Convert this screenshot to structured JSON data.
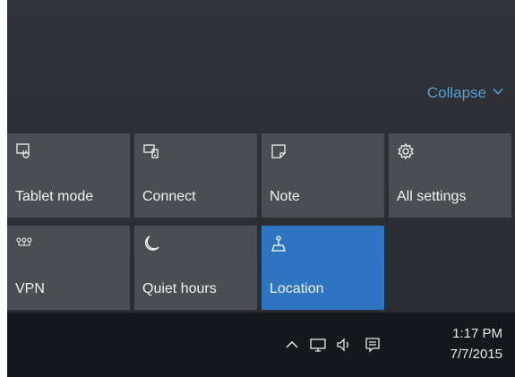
{
  "action_center": {
    "collapse_label": "Collapse",
    "tiles": [
      {
        "label": "Tablet mode",
        "icon": "tablet-mode-icon",
        "active": false
      },
      {
        "label": "Connect",
        "icon": "connect-icon",
        "active": false
      },
      {
        "label": "Note",
        "icon": "note-icon",
        "active": false
      },
      {
        "label": "All settings",
        "icon": "gear-icon",
        "active": false
      },
      {
        "label": "VPN",
        "icon": "vpn-icon",
        "active": false
      },
      {
        "label": "Quiet hours",
        "icon": "moon-icon",
        "active": false
      },
      {
        "label": "Location",
        "icon": "location-icon",
        "active": true
      }
    ]
  },
  "taskbar": {
    "tray_icons": [
      "chevron-up-icon",
      "network-icon",
      "volume-icon",
      "action-center-icon"
    ],
    "time": "1:17 PM",
    "date": "7/7/2015"
  },
  "colors": {
    "panel_bg": "#2c3035",
    "tile_bg": "#4a4d52",
    "active_tile_bg": "#2f74c0",
    "taskbar_bg": "#15181c",
    "accent_link": "#5a9fd6"
  }
}
